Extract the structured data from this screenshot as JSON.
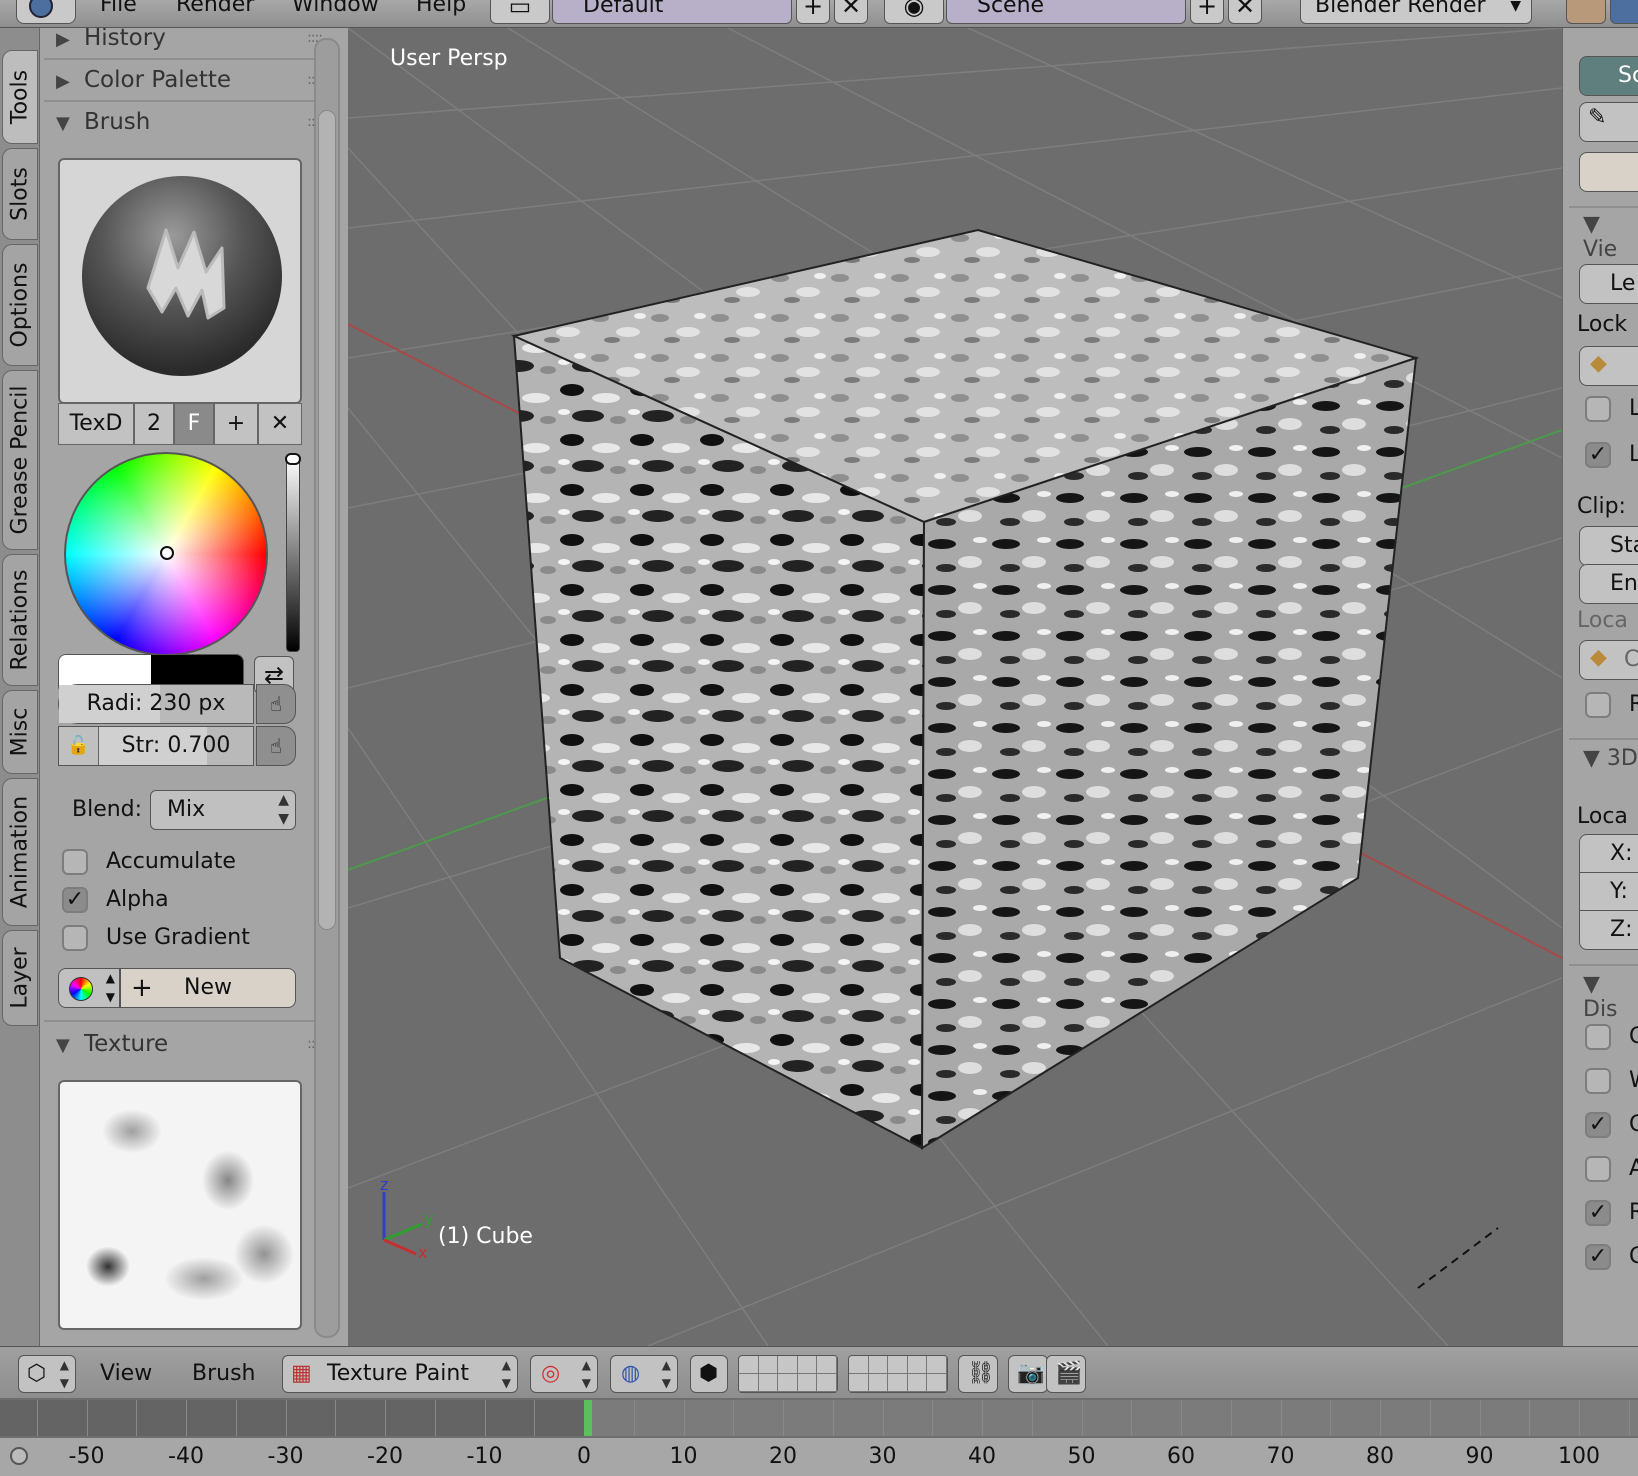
{
  "top_menu": {
    "file": "File",
    "render": "Render",
    "window": "Window",
    "help": "Help"
  },
  "screen_layout": "Default",
  "scene": "Scene",
  "render_engine": "Blender Render",
  "left_tabs": [
    "Tools",
    "Slots",
    "Options",
    "Grease Pencil",
    "Relations",
    "Misc",
    "Animation",
    "Layer"
  ],
  "panels": {
    "history": "History",
    "color_palette": "Color Palette",
    "brush": "Brush",
    "texture": "Texture"
  },
  "brush": {
    "name": "TexD",
    "users": "2",
    "fake_user": "F",
    "radius_label": "Radi:",
    "radius_value": "230 px",
    "radius_fraction": 0.52,
    "strength_label": "Str:",
    "strength_value": "0.700",
    "strength_fraction": 0.7,
    "blend_label": "Blend:",
    "blend_value": "Mix",
    "accumulate": {
      "label": "Accumulate",
      "checked": false
    },
    "alpha": {
      "label": "Alpha",
      "checked": true
    },
    "use_gradient": {
      "label": "Use Gradient",
      "checked": false
    },
    "new_label": "New"
  },
  "viewport": {
    "view_name": "User Persp",
    "object_label": "(1) Cube",
    "axis_x": "x",
    "axis_y": "y",
    "axis_z": "z"
  },
  "right_panel": {
    "view_header": "Vie",
    "lens": "Le",
    "lock": "Lock",
    "lock_item1": "L",
    "lock_item2": "L",
    "clip": "Clip:",
    "clip_start": "Sta",
    "clip_end": "En",
    "local_camera": "Loca",
    "camera_field": "C",
    "render_border": "R",
    "cursor_header": "3D",
    "location": "Loca",
    "x": "X:",
    "y": "Y:",
    "z": "Z:",
    "display_header": "Dis",
    "display_items": [
      {
        "label": "C",
        "checked": false
      },
      {
        "label": "W",
        "checked": false
      },
      {
        "label": "C",
        "checked": true
      },
      {
        "label": "A",
        "checked": false
      },
      {
        "label": "R",
        "checked": true
      },
      {
        "label": "C",
        "checked": true
      }
    ]
  },
  "bottom_header": {
    "view": "View",
    "brush": "Brush",
    "mode": "Texture Paint"
  },
  "timeline": {
    "current_frame": 0,
    "ticks": [
      "-50",
      "-40",
      "-30",
      "-20",
      "-10",
      "0",
      "10",
      "20",
      "30",
      "40",
      "50",
      "60",
      "70",
      "80",
      "90",
      "100"
    ]
  },
  "colors": {
    "viewport_bg": "#6d6d6d",
    "panel_bg": "#a5a5a5",
    "current_frame": "#5cbe5c",
    "primary_color": "#ffffff",
    "secondary_color": "#000000"
  }
}
